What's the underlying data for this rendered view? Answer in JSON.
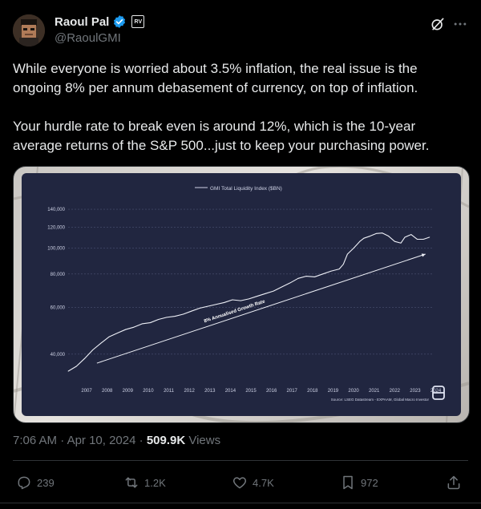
{
  "author": {
    "name": "Raoul Pal",
    "handle": "@RaoulGMI",
    "affiliate_badge": "RV"
  },
  "icons": {
    "avatar": "avatar",
    "verified": "verified-badge-icon",
    "grok": "grok-icon",
    "more": "more-icon",
    "reply": "reply-icon",
    "repost": "repost-icon",
    "like": "like-icon",
    "bookmark": "bookmark-icon",
    "share": "share-icon"
  },
  "colors": {
    "background": "#000000",
    "text": "#e7e9ea",
    "secondary": "#71767b",
    "verified": "#1d9bf0",
    "chart_bg": "#212640"
  },
  "tweet": {
    "paragraph1": "While everyone is worried about 3.5% inflation, the real issue is the ongoing 8% per annum debasement of currency, on top of inflation.",
    "paragraph2": "Your hurdle rate to break even is around 12%, which is the 10-year average returns of the S&P 500...just to keep your purchasing power."
  },
  "meta": {
    "time": "7:06 AM",
    "separator1": "·",
    "date": "Apr 10, 2024",
    "separator2": "·",
    "views_count": "509.9K",
    "views_label": "Views"
  },
  "actions": {
    "replies": "239",
    "reposts": "1.2K",
    "likes": "4.7K",
    "bookmarks": "972"
  },
  "chart_data": {
    "type": "line",
    "title": "",
    "legend": "GMI Total Liquidity Index ($BN)",
    "annotation": "8% Annualised Growth Rate",
    "source": "Source: LSEG Datastream - EXPAAM, Global Macro Investor",
    "x_ticks": [
      "2007",
      "2008",
      "2009",
      "2010",
      "2011",
      "2012",
      "2013",
      "2014",
      "2015",
      "2016",
      "2017",
      "2018",
      "2019",
      "2020",
      "2021",
      "2022",
      "2023",
      "2024"
    ],
    "y_ticks": [
      "40,000",
      "60,000",
      "80,000",
      "100,000",
      "120,000",
      "140,000"
    ],
    "y_tick_values": [
      40000,
      60000,
      80000,
      100000,
      120000,
      140000
    ],
    "scale": "log",
    "ylim": [
      32000,
      145000
    ],
    "xlim": [
      2006.6,
      2024.4
    ],
    "grid": true,
    "series": [
      {
        "name": "GMI Total Liquidity Index ($BN)",
        "x": [
          2006.6,
          2007.0,
          2007.4,
          2007.8,
          2008.2,
          2008.6,
          2009.0,
          2009.4,
          2009.8,
          2010.2,
          2010.6,
          2011.0,
          2011.4,
          2011.8,
          2012.2,
          2012.6,
          2013.0,
          2013.4,
          2013.8,
          2014.2,
          2014.6,
          2015.0,
          2015.4,
          2015.8,
          2016.2,
          2016.6,
          2017.0,
          2017.4,
          2017.8,
          2018.2,
          2018.6,
          2019.0,
          2019.4,
          2019.8,
          2020.0,
          2020.2,
          2020.5,
          2020.8,
          2021.0,
          2021.3,
          2021.6,
          2021.9,
          2022.2,
          2022.5,
          2022.8,
          2023.0,
          2023.3,
          2023.6,
          2023.9,
          2024.2
        ],
        "y": [
          34500,
          36000,
          38500,
          41500,
          44000,
          46500,
          48000,
          49500,
          50500,
          52000,
          52500,
          54000,
          55000,
          55500,
          56500,
          58000,
          59500,
          60500,
          61500,
          62500,
          64000,
          63500,
          64500,
          66000,
          67500,
          69000,
          71500,
          74000,
          77000,
          78500,
          78000,
          80000,
          82000,
          83500,
          87000,
          95000,
          100000,
          106000,
          109000,
          111000,
          113500,
          114000,
          111000,
          106000,
          104500,
          110000,
          112500,
          108000,
          108000,
          110000
        ]
      },
      {
        "name": "8% Annualised Growth Rate",
        "x": [
          2008.0,
          2024.0
        ],
        "y": [
          37000,
          95000
        ]
      }
    ]
  }
}
